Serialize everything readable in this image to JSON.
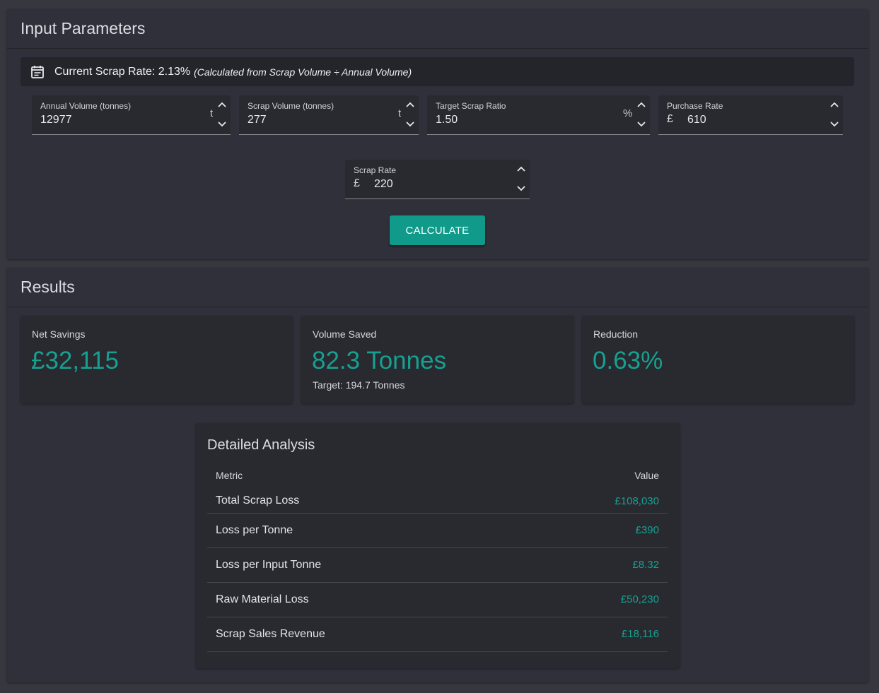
{
  "input_panel": {
    "title": "Input Parameters",
    "info": {
      "label": "Current Scrap Rate: 2.13%",
      "note": "(Calculated from Scrap Volume ÷ Annual Volume)"
    },
    "fields": {
      "annual_volume": {
        "label": "Annual Volume (tonnes)",
        "value": "12977",
        "suffix": "t"
      },
      "scrap_volume": {
        "label": "Scrap Volume (tonnes)",
        "value": "277",
        "suffix": "t"
      },
      "target_ratio": {
        "label": "Target Scrap Ratio",
        "value": "1.50",
        "suffix": "%"
      },
      "purchase_rate": {
        "label": "Purchase Rate",
        "value": "610",
        "prefix": "£"
      },
      "scrap_rate": {
        "label": "Scrap Rate",
        "value": "220",
        "prefix": "£"
      }
    },
    "calculate_label": "CALCULATE"
  },
  "results_panel": {
    "title": "Results",
    "cards": {
      "net_savings": {
        "label": "Net Savings",
        "value": "£32,115"
      },
      "volume_saved": {
        "label": "Volume Saved",
        "value": "82.3 Tonnes",
        "sub": "Target: 194.7 Tonnes"
      },
      "reduction": {
        "label": "Reduction",
        "value": "0.63%"
      }
    },
    "analysis": {
      "title": "Detailed Analysis",
      "headers": {
        "metric": "Metric",
        "value": "Value"
      },
      "rows": [
        {
          "metric": "Total Scrap Loss",
          "value": "£108,030"
        },
        {
          "metric": "Loss per Tonne",
          "value": "£390"
        },
        {
          "metric": "Loss per Input Tonne",
          "value": "£8.32"
        },
        {
          "metric": "Raw Material Loss",
          "value": "£50,230"
        },
        {
          "metric": "Scrap Sales Revenue",
          "value": "£18,116"
        }
      ]
    }
  },
  "colors": {
    "accent": "#0f9a89",
    "value_text": "#17a090",
    "page_bg": "#37373f",
    "panel_bg": "#30303a"
  }
}
